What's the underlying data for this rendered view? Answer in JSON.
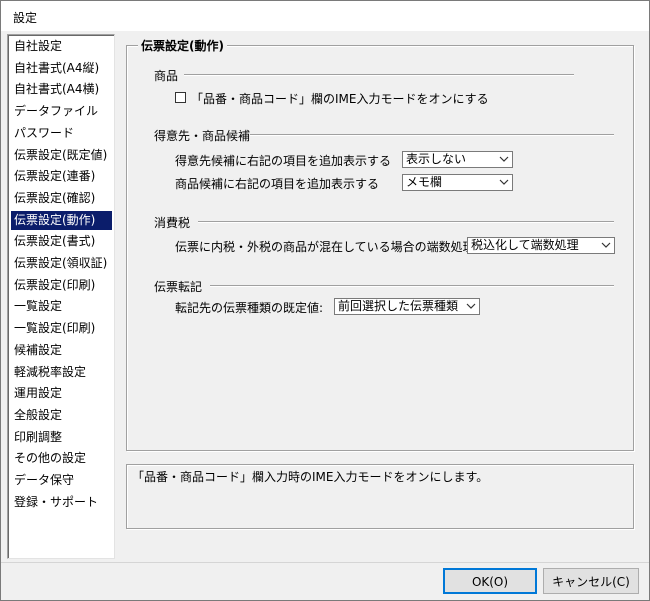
{
  "window": {
    "title": "設定"
  },
  "sidebar": {
    "items": [
      {
        "label": "自社設定"
      },
      {
        "label": "自社書式(A4縦)"
      },
      {
        "label": "自社書式(A4横)"
      },
      {
        "label": "データファイル"
      },
      {
        "label": "パスワード"
      },
      {
        "label": "伝票設定(既定値)"
      },
      {
        "label": "伝票設定(連番)"
      },
      {
        "label": "伝票設定(確認)"
      },
      {
        "label": "伝票設定(動作)",
        "selected": true
      },
      {
        "label": "伝票設定(書式)"
      },
      {
        "label": "伝票設定(領収証)"
      },
      {
        "label": "伝票設定(印刷)"
      },
      {
        "label": "一覧設定"
      },
      {
        "label": "一覧設定(印刷)"
      },
      {
        "label": "候補設定"
      },
      {
        "label": "軽減税率設定"
      },
      {
        "label": "運用設定"
      },
      {
        "label": "全般設定"
      },
      {
        "label": "印刷調整"
      },
      {
        "label": "その他の設定"
      },
      {
        "label": "データ保守"
      },
      {
        "label": "登録・サポート"
      }
    ]
  },
  "panel": {
    "title": "伝票設定(動作)",
    "shohin": {
      "heading": "商品",
      "ime_checkbox_label": "「品番・商品コード」欄のIME入力モードをオンにする",
      "ime_checked": false
    },
    "candidates": {
      "heading": "得意先・商品候補",
      "customer_label": "得意先候補に右記の項目を追加表示する",
      "customer_value": "表示しない",
      "product_label": "商品候補に右記の項目を追加表示する",
      "product_value": "メモ欄"
    },
    "tax": {
      "heading": "消費税",
      "mixed_label": "伝票に内税・外税の商品が混在している場合の端数処理",
      "mixed_value": "税込化して端数処理"
    },
    "transfer": {
      "heading": "伝票転記",
      "default_label": "転記先の伝票種類の既定値:",
      "default_value": "前回選択した伝票種類"
    }
  },
  "description": {
    "text": "「品番・商品コード」欄入力時のIME入力モードをオンにします。"
  },
  "buttons": {
    "ok": "OK(O)",
    "cancel": "キャンセル(C)"
  }
}
